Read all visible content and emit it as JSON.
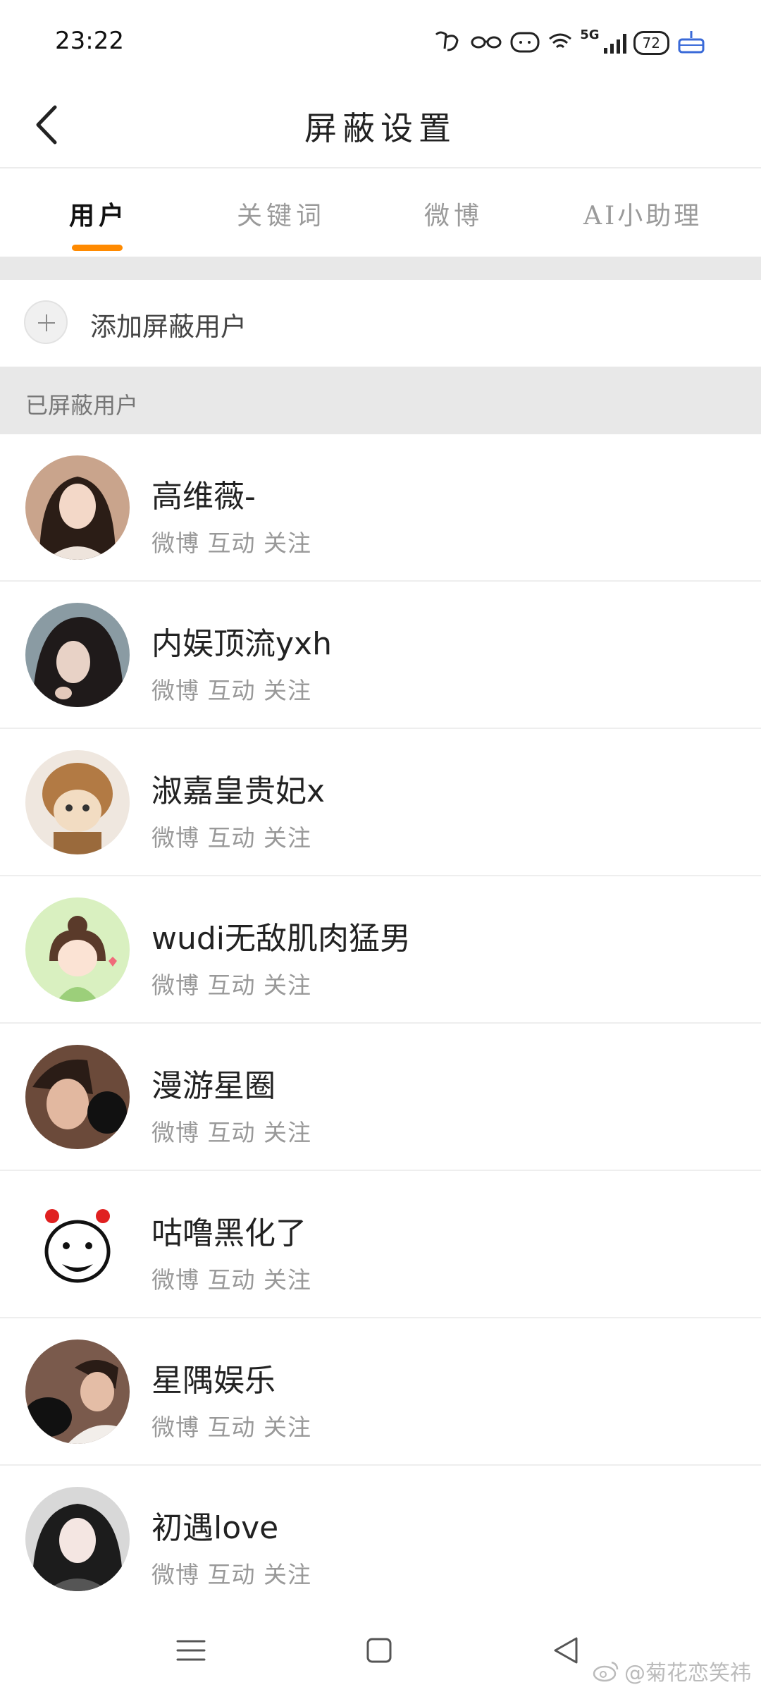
{
  "status_bar": {
    "time": "23:22",
    "network": "5G",
    "battery": "72",
    "icons": [
      "app-notification-icon",
      "glasses-icon",
      "cat-face-icon",
      "wifi-icon",
      "signal-icon",
      "battery-icon",
      "cake-icon"
    ]
  },
  "header": {
    "title": "屏蔽设置",
    "back_icon": "back-arrow-icon"
  },
  "tabs": [
    {
      "label": "用户",
      "active": true
    },
    {
      "label": "关键词",
      "active": false
    },
    {
      "label": "微博",
      "active": false
    },
    {
      "label": "AI小助理",
      "active": false
    }
  ],
  "accent_color": "#ff8a00",
  "add_user": {
    "label": "添加屏蔽用户",
    "icon": "plus-icon"
  },
  "section": {
    "label": "已屏蔽用户"
  },
  "users": [
    {
      "name": "高维薇-",
      "meta": "微博 互动 关注"
    },
    {
      "name": "内娱顶流yxh",
      "meta": "微博 互动 关注"
    },
    {
      "name": "淑嘉皇贵妃x",
      "meta": "微博 互动 关注"
    },
    {
      "name": "wudi无敌肌肉猛男",
      "meta": "微博 互动 关注"
    },
    {
      "name": "漫游星圈",
      "meta": "微博 互动 关注"
    },
    {
      "name": "咕噜黑化了",
      "meta": "微博 互动 关注"
    },
    {
      "name": "星隅娱乐",
      "meta": "微博 互动 关注"
    },
    {
      "name": "初遇love",
      "meta": "微博 互动 关注"
    }
  ],
  "nav_bar": {
    "icons": [
      "menu-icon",
      "home-square-icon",
      "back-triangle-icon"
    ]
  },
  "watermark": {
    "text": "@菊花恋笑祎",
    "icon": "weibo-logo-icon"
  }
}
